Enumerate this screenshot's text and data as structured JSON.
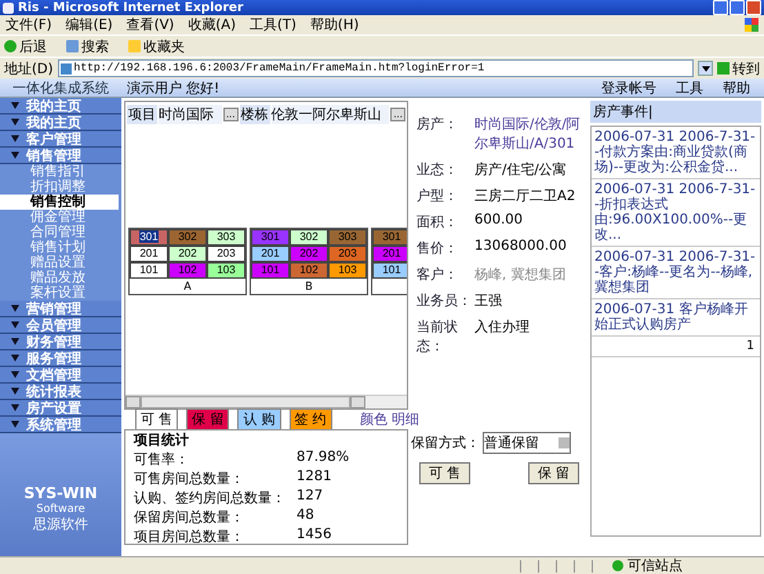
{
  "browser": {
    "title": "Ris - Microsoft Internet Explorer",
    "menu": [
      "文件(F)",
      "编辑(E)",
      "查看(V)",
      "收藏(A)",
      "工具(T)",
      "帮助(H)"
    ],
    "toolbar": [
      "后退",
      "搜索",
      "收藏夹"
    ],
    "address_label": "地址(D)",
    "url": "http://192.168.196.6:2003/FrameMain/FrameMain.htm?loginError=1",
    "go": "转到"
  },
  "app": {
    "name": "一体化集成系统",
    "greeting": "演示用户 您好!",
    "links": [
      "登录帐号",
      "工具",
      "帮助"
    ]
  },
  "sidebar": {
    "items": [
      {
        "label": "我的主页"
      },
      {
        "label": "我的主页"
      },
      {
        "label": "客户管理"
      },
      {
        "label": "销售管理",
        "children": [
          {
            "label": "销售指引",
            "selected": false
          },
          {
            "label": "折扣调整",
            "selected": false
          },
          {
            "label": "销售控制",
            "selected": true
          },
          {
            "label": "佣金管理",
            "selected": false
          },
          {
            "label": "合同管理",
            "selected": false
          },
          {
            "label": "销售计划",
            "selected": false
          },
          {
            "label": "赠品设置",
            "selected": false
          },
          {
            "label": "赠品发放",
            "selected": false
          },
          {
            "label": "案杆设置",
            "selected": false
          }
        ]
      },
      {
        "label": "营销管理"
      },
      {
        "label": "会员管理"
      },
      {
        "label": "财务管理"
      },
      {
        "label": "服务管理"
      },
      {
        "label": "文档管理"
      },
      {
        "label": "统计报表"
      },
      {
        "label": "房产设置"
      },
      {
        "label": "系统管理"
      }
    ],
    "logo": {
      "brand": "SYS-WIN",
      "sub": "Software",
      "local": "思源软件"
    }
  },
  "filters": [
    {
      "label": "项目",
      "value": "时尚国际",
      "button": "..."
    },
    {
      "label": "楼栋",
      "value": "伦敦一阿尔卑斯山",
      "button": "..."
    }
  ],
  "buildings": [
    {
      "name": "A",
      "rows": [
        [
          {
            "number": "301",
            "color": "#c86464",
            "selected": true
          },
          {
            "number": "302",
            "color": "#9c6430",
            "selected": false
          },
          {
            "number": "303",
            "color": "#ccffcc",
            "selected": false
          }
        ],
        [
          {
            "number": "201",
            "color": "#ffffff",
            "selected": false
          },
          {
            "number": "202",
            "color": "#ccffcc",
            "selected": false
          },
          {
            "number": "203",
            "color": "#ffffff",
            "selected": false
          }
        ],
        [
          {
            "number": "101",
            "color": "#ffffff",
            "selected": false
          },
          {
            "number": "102",
            "color": "#cc00ff",
            "selected": false
          },
          {
            "number": "103",
            "color": "#99ff99",
            "selected": false
          }
        ]
      ]
    },
    {
      "name": "B",
      "rows": [
        [
          {
            "number": "301",
            "color": "#9933ff",
            "selected": false
          },
          {
            "number": "302",
            "color": "#ccffcc",
            "selected": false
          },
          {
            "number": "303",
            "color": "#996633",
            "selected": false
          }
        ],
        [
          {
            "number": "201",
            "color": "#99ccff",
            "selected": false
          },
          {
            "number": "202",
            "color": "#cc00ff",
            "selected": false
          },
          {
            "number": "203",
            "color": "#dd6622",
            "selected": false
          }
        ],
        [
          {
            "number": "101",
            "color": "#cc00ff",
            "selected": false
          },
          {
            "number": "102",
            "color": "#cc6633",
            "selected": false
          },
          {
            "number": "103",
            "color": "#ff9900",
            "selected": false
          }
        ]
      ]
    },
    {
      "rows": [
        [
          {
            "number": "301",
            "color": "#996633",
            "selected": false
          }
        ],
        [
          {
            "number": "201",
            "color": "#cc00ff",
            "selected": false
          }
        ],
        [
          {
            "number": "101",
            "color": "#99ccff",
            "selected": false
          }
        ]
      ]
    }
  ],
  "legend": [
    {
      "label": "可 售",
      "color": "#ffffff"
    },
    {
      "label": "保 留",
      "color": "#e0004a"
    },
    {
      "label": "认 购",
      "color": "#99ccff"
    },
    {
      "label": "签 约",
      "color": "#ff9900"
    }
  ],
  "legend_link": "颜色 明细",
  "details": [
    {
      "label": "房产：",
      "value": "时尚国际/伦敦/阿尔卑斯山/A/301",
      "kind": "link"
    },
    {
      "label": "业态：",
      "value": "房产/住宅/公寓",
      "kind": "plain"
    },
    {
      "label": "户型：",
      "value": "三房二厅二卫A2",
      "kind": "plain"
    },
    {
      "label": "面积：",
      "value": "600.00",
      "kind": "plain"
    },
    {
      "label": "售价：",
      "value": "13068000.00",
      "kind": "plain"
    },
    {
      "label": "客户：",
      "value": "杨峰, 冀想集团",
      "kind": "muted"
    },
    {
      "label": "业务员：",
      "value": "王强",
      "kind": "plain"
    },
    {
      "label": "当前状态：",
      "value": "入住办理",
      "kind": "plain"
    }
  ],
  "events": {
    "title": "房产事件|",
    "items": [
      "2006-07-31 2006-7-31--付款方案由:商业贷款(商场)--更改为:公积金贷...",
      "2006-07-31 2006-7-31--折扣表达式由:96.00X100.00%--更改...",
      "2006-07-31 2006-7-31--客户:杨峰--更名为--杨峰,冀想集团",
      "2006-07-31 客户杨峰开始正式认购房产"
    ],
    "page": "1"
  },
  "stats": {
    "title": "项目统计",
    "rows": [
      {
        "label": "可售率：",
        "value": "87.98%"
      },
      {
        "label": "可售房间总数量：",
        "value": "1281"
      },
      {
        "label": "认购、签约房间总数量：",
        "value": "127"
      },
      {
        "label": "保留房间总数量：",
        "value": "48"
      },
      {
        "label": "项目房间总数量：",
        "value": "1456"
      }
    ]
  },
  "retain": {
    "label": "保留方式：",
    "value": "普通保留",
    "buttons": [
      "可 售",
      "保 留"
    ]
  },
  "status_bar": {
    "zone": "可信站点"
  }
}
